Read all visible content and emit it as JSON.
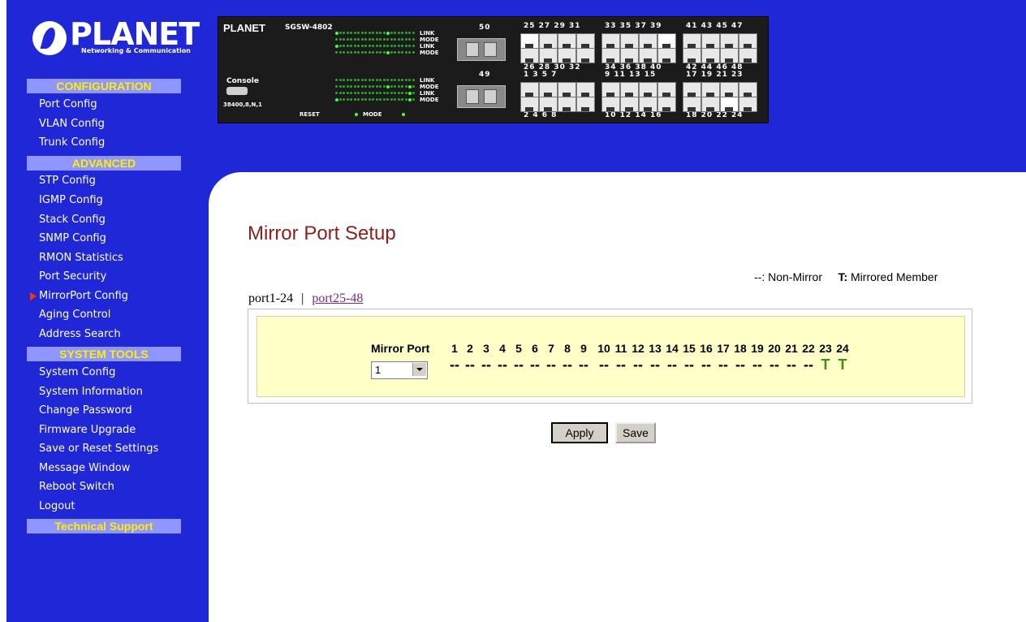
{
  "logo": {
    "word": "PLANET",
    "tagline": "Networking & Communication"
  },
  "sidebar": {
    "sections": [
      {
        "title": "CONFIGURATION",
        "items": [
          "Port Config",
          "VLAN Config",
          "Trunk Config"
        ]
      },
      {
        "title": "ADVANCED",
        "items": [
          "STP Config",
          "IGMP Config",
          "Stack Config",
          "SNMP Config",
          "RMON Statistics",
          "Port Security",
          "MirrorPort Config",
          "Aging Control",
          "Address Search"
        ]
      },
      {
        "title": "SYSTEM TOOLS",
        "items": [
          "System Config",
          "System Information",
          "Change Password",
          "Firmware Upgrade",
          "Save or Reset Settings",
          "Message Window",
          "Reboot Switch",
          "Logout"
        ]
      },
      {
        "title": "Technical Support",
        "items": []
      }
    ],
    "active_item": "MirrorPort Config"
  },
  "device": {
    "brand": "PLANET",
    "model": "SGSW-4802",
    "console_label": "Console",
    "console_settings": "38400,8,N,1",
    "reset_label": "RESET",
    "mode_label": "MODE",
    "led_labels": [
      "LINK",
      "MODE",
      "LINK",
      "MODE"
    ],
    "fiber_top": "50",
    "fiber_bottom": "49",
    "top_odd_ports": [
      "25 27 29 31",
      "33 35 37 39",
      "41 43 45 47"
    ],
    "mid_even_ports": [
      "26 28 30 32",
      "34 36 38 40",
      "42 44 46 48"
    ],
    "mid_odd_ports": [
      "1  3  5  7",
      "9  11 13 15",
      "17 19 21 23"
    ],
    "bottom_even_ports": [
      "2  4  6  8",
      "10 12 14 16",
      "18 20 22 24"
    ]
  },
  "main": {
    "title": "Mirror Port Setup",
    "legend": {
      "none_symbol": "--:",
      "none_text": "Non-Mirror",
      "t_symbol": "T:",
      "t_text": "Mirrored Member"
    },
    "tabs": {
      "current": "port1-24",
      "separator": "|",
      "other": "port25-48"
    },
    "table": {
      "header_label": "Mirror Port",
      "ports": [
        "1",
        "2",
        "3",
        "4",
        "5",
        "6",
        "7",
        "8",
        "9",
        "10",
        "11",
        "12",
        "13",
        "14",
        "15",
        "16",
        "17",
        "18",
        "19",
        "20",
        "21",
        "22",
        "23",
        "24"
      ],
      "states": [
        "--",
        "--",
        "--",
        "--",
        "--",
        "--",
        "--",
        "--",
        "--",
        "--",
        "--",
        "--",
        "--",
        "--",
        "--",
        "--",
        "--",
        "--",
        "--",
        "--",
        "--",
        "--",
        "T",
        "T"
      ],
      "mirror_port_value": "1"
    },
    "buttons": {
      "apply": "Apply",
      "save": "Save"
    }
  },
  "colors": {
    "sidebar_bg": "#1f27d6",
    "section_head_bg": "#8f97ff",
    "section_head_text": "#ffee00",
    "title": "#8b1f1f",
    "panel_bg": "#ffffc8",
    "mirrored": "#3f8f12"
  }
}
